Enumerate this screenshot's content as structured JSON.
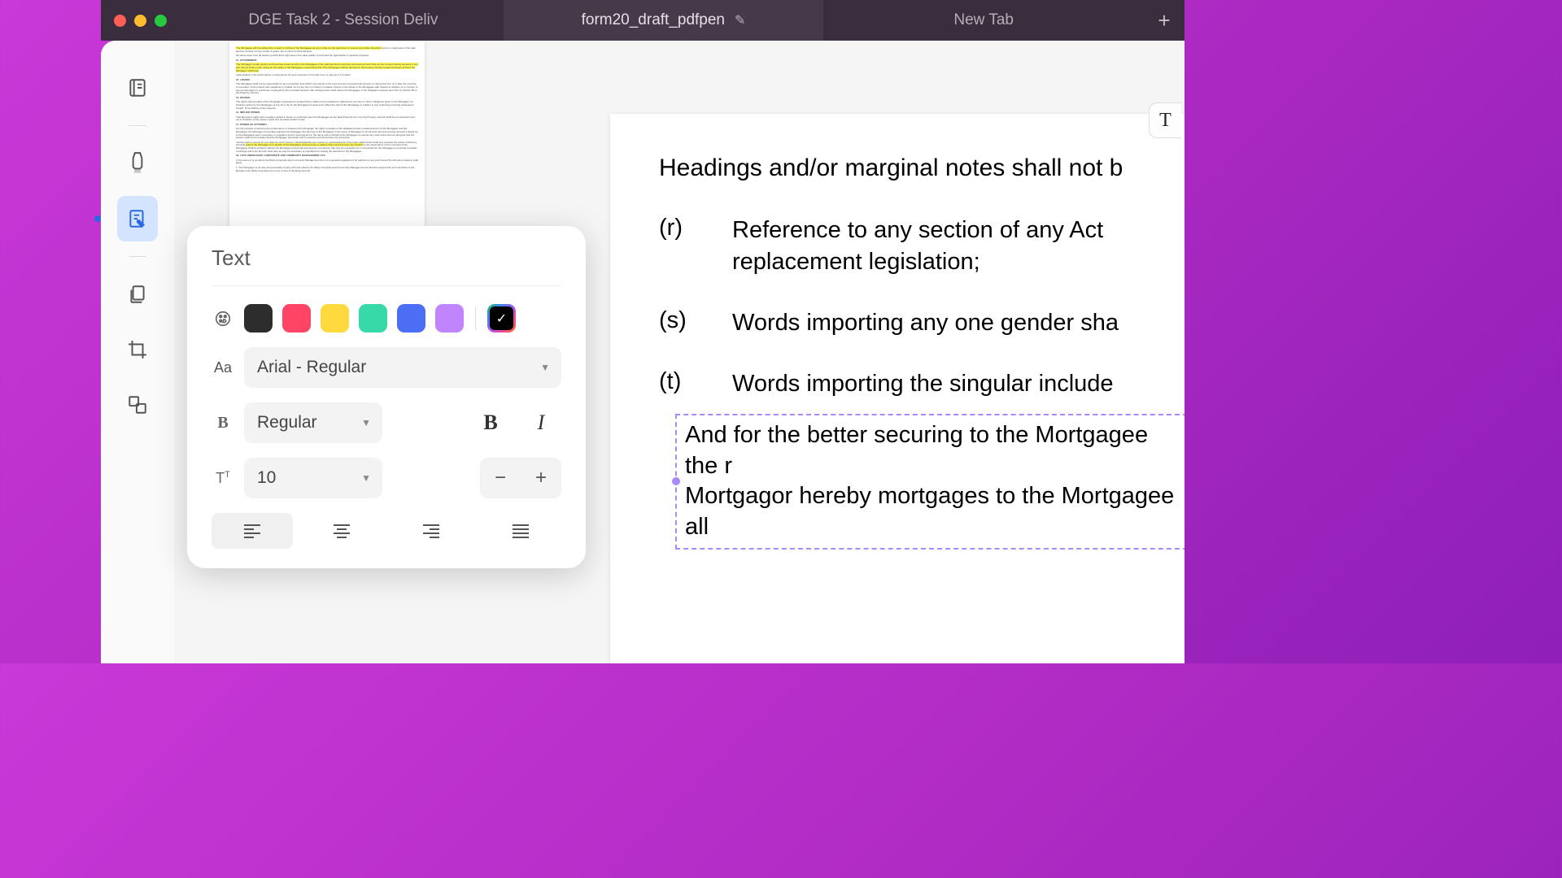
{
  "tabs": {
    "items": [
      {
        "label": "DGE Task 2 - Session Deliv"
      },
      {
        "label": "form20_draft_pdfpen"
      },
      {
        "label": "New Tab"
      }
    ]
  },
  "sidebar": {
    "items": [
      "contents",
      "highlighter",
      "edit-text",
      "documents",
      "crop",
      "layers"
    ]
  },
  "textPanel": {
    "title": "Text",
    "colors": [
      "#2d2d2d",
      "#ff4466",
      "#ffd93d",
      "#38d9a9",
      "#4c6ef5",
      "#c084fc"
    ],
    "font": "Arial - Regular",
    "weight": "Regular",
    "size": "10",
    "alignment": "left"
  },
  "page": {
    "heading": "Headings and/or marginal notes shall not b",
    "clauses": [
      {
        "label": "(r)",
        "text": "Reference to any section of any Act replacement legislation;"
      },
      {
        "label": "(s)",
        "text": "Words importing any one gender sha"
      },
      {
        "label": "(t)",
        "text": "Words importing the singular include"
      }
    ],
    "editBox": "And for the better securing to the Mortgagee the r\nMortgagor hereby mortgages to the Mortgagee all"
  },
  "floatTool": "T"
}
